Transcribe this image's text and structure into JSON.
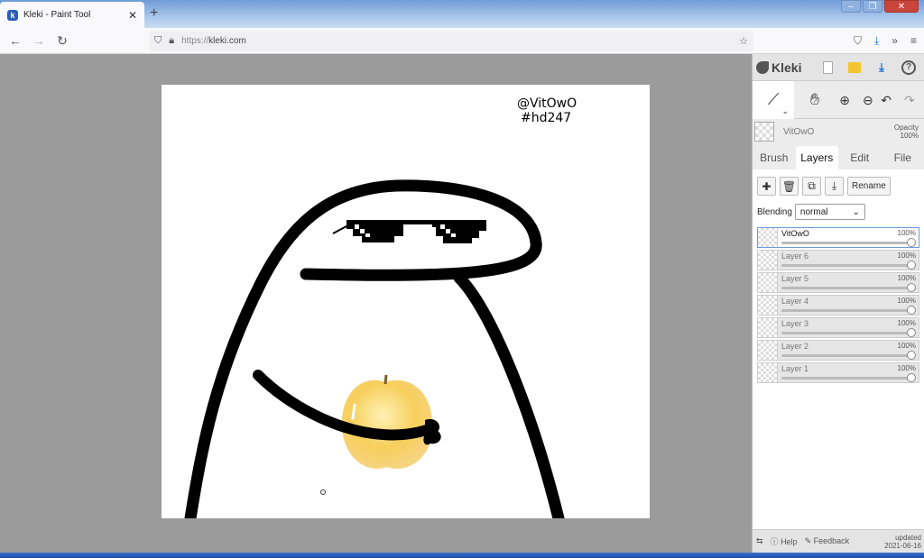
{
  "browser": {
    "tab_title": "Kleki - Paint Tool",
    "favicon_letter": "k",
    "url_protocol": "https://",
    "url_host": "kleki.com"
  },
  "canvas": {
    "line1": "@VitOwO",
    "line2": "#hd247"
  },
  "panel": {
    "brand": "Kleki",
    "brush_name": "VitOwO",
    "opacity_label": "Opacity",
    "opacity_value": "100%",
    "subtabs": [
      "Brush",
      "Layers",
      "Edit",
      "File"
    ],
    "rename_label": "Rename",
    "blending_label": "Blending",
    "blending_value": "normal",
    "layers": [
      {
        "name": "VitOwO",
        "opacity": "100%",
        "active": true,
        "level": 1.0
      },
      {
        "name": "Layer 6",
        "opacity": "100%",
        "active": false,
        "level": 1.0
      },
      {
        "name": "Layer 5",
        "opacity": "100%",
        "active": false,
        "level": 1.0
      },
      {
        "name": "Layer 4",
        "opacity": "100%",
        "active": false,
        "level": 1.0
      },
      {
        "name": "Layer 3",
        "opacity": "100%",
        "active": false,
        "level": 1.0
      },
      {
        "name": "Layer 2",
        "opacity": "100%",
        "active": false,
        "level": 1.0
      },
      {
        "name": "Layer 1",
        "opacity": "100%",
        "active": false,
        "level": 1.0
      }
    ],
    "help_label": "Help",
    "feedback_label": "Feedback",
    "updated_label": "updated",
    "updated_date": "2021-06-16"
  },
  "colors": {
    "accent": "#1b6fd6",
    "apple": "#f6cf5c",
    "stroke": "#000000"
  }
}
